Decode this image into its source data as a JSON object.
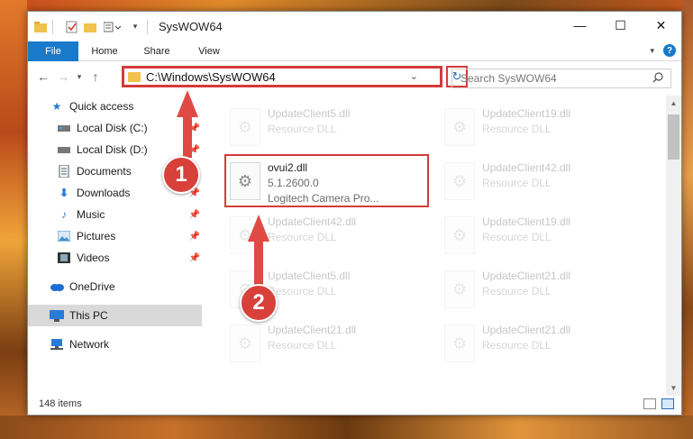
{
  "window": {
    "title": "SysWOW64",
    "controls": {
      "minimize": "—",
      "maximize": "☐",
      "close": "✕"
    }
  },
  "ribbon": {
    "tabs": [
      "File",
      "Home",
      "Share",
      "View"
    ],
    "help": "?"
  },
  "nav": {
    "address": "C:\\Windows\\SysWOW64",
    "search_placeholder": "Search SysWOW64"
  },
  "sidebar": {
    "items": [
      {
        "label": "Quick access",
        "icon": "star-icon",
        "color": "#2a7ad8"
      },
      {
        "label": "Local Disk (C:)",
        "icon": "drive-icon",
        "color": "#555555"
      },
      {
        "label": "Local Disk (D:)",
        "icon": "drive-icon",
        "color": "#555555"
      },
      {
        "label": "Documents",
        "icon": "documents-icon",
        "color": "#4a5560"
      },
      {
        "label": "Downloads",
        "icon": "download-icon",
        "color": "#2a7ad8"
      },
      {
        "label": "Music",
        "icon": "music-icon",
        "color": "#2a7ad8"
      },
      {
        "label": "Pictures",
        "icon": "pictures-icon",
        "color": "#4a90c8"
      },
      {
        "label": "Videos",
        "icon": "videos-icon",
        "color": "#555555"
      },
      {
        "label": "OneDrive",
        "icon": "cloud-icon",
        "color": "#1c6fd1"
      },
      {
        "label": "This PC",
        "icon": "computer-icon",
        "color": "#2a7ad8"
      },
      {
        "label": "Network",
        "icon": "network-icon",
        "color": "#2a7ad8"
      }
    ]
  },
  "files": [
    {
      "name": "UpdateClient5.dll",
      "sub": "Resource DLL"
    },
    {
      "name": "UpdateClient19.dll",
      "sub": "Resource DLL"
    },
    {
      "name": "ovui2.dll",
      "version": "5.1.2600.0",
      "description": "Logitech Camera Pro..."
    },
    {
      "name": "UpdateClient42.dll",
      "sub": "Resource DLL"
    },
    {
      "name": "UpdateClient42.dll",
      "sub": "Resource DLL"
    },
    {
      "name": "UpdateClient19.dll",
      "sub": "Resource DLL"
    },
    {
      "name": "UpdateClient5.dll",
      "sub": "Resource DLL"
    },
    {
      "name": "UpdateClient21.dll",
      "sub": "Resource DLL"
    },
    {
      "name": "UpdateClient21.dll",
      "sub": "Resource DLL"
    },
    {
      "name": "UpdateClient21.dll",
      "sub": "Resource DLL"
    }
  ],
  "status": {
    "items_count": "148 items"
  },
  "annotations": {
    "step1": "1",
    "step2": "2",
    "color": "#d43b3b"
  }
}
